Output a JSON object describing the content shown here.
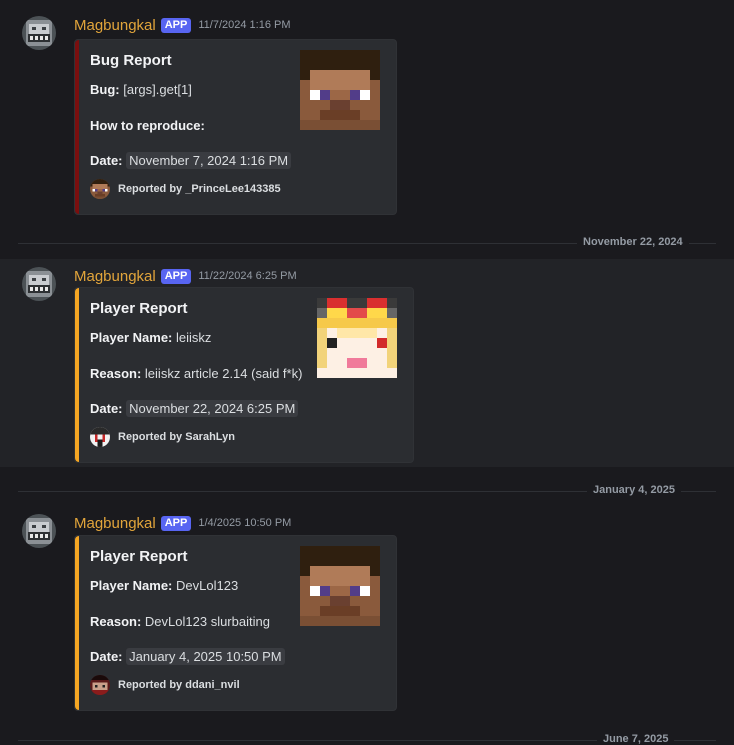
{
  "messages": [
    {
      "username": "Magbungkal",
      "badge": "APP",
      "timestamp": "11/7/2024 1:16 PM",
      "embed": {
        "accent": "#7a0f0f",
        "title": "Bug Report",
        "field1_label": "Bug:",
        "field1_value": "[args].get[1]",
        "field2_label": "How to reproduce:",
        "field2_value": "",
        "date_label": "Date:",
        "date_value": "November 7, 2024 1:16 PM",
        "footer": "Reported by _PrinceLee143385",
        "thumbnail": "steve-skin-icon",
        "footer_icon": "steve-avatar-icon"
      }
    },
    {
      "username": "Magbungkal",
      "badge": "APP",
      "timestamp": "11/22/2024 6:25 PM",
      "embed": {
        "accent": "#f5a623",
        "title": "Player Report",
        "field1_label": "Player Name:",
        "field1_value": "leiiskz",
        "field2_label": "Reason:",
        "field2_value": "leiiskz article 2.14 (said f*k)",
        "date_label": "Date:",
        "date_value": "November 22, 2024 6:25 PM",
        "footer": "Reported by SarahLyn",
        "thumbnail": "blonde-skin-icon",
        "footer_icon": "sarahlyn-avatar-icon"
      }
    },
    {
      "username": "Magbungkal",
      "badge": "APP",
      "timestamp": "1/4/2025 10:50 PM",
      "embed": {
        "accent": "#f5a623",
        "title": "Player Report",
        "field1_label": "Player Name:",
        "field1_value": "DevLol123",
        "field2_label": "Reason:",
        "field2_value": "DevLol123 slurbaiting",
        "date_label": "Date:",
        "date_value": "January 4, 2025 10:50 PM",
        "footer": "Reported by ddani_nvil",
        "thumbnail": "steve-skin-icon",
        "footer_icon": "ddani-avatar-icon"
      }
    }
  ],
  "dividers": [
    "November 22, 2024",
    "January 4, 2025",
    "June 7, 2025"
  ]
}
